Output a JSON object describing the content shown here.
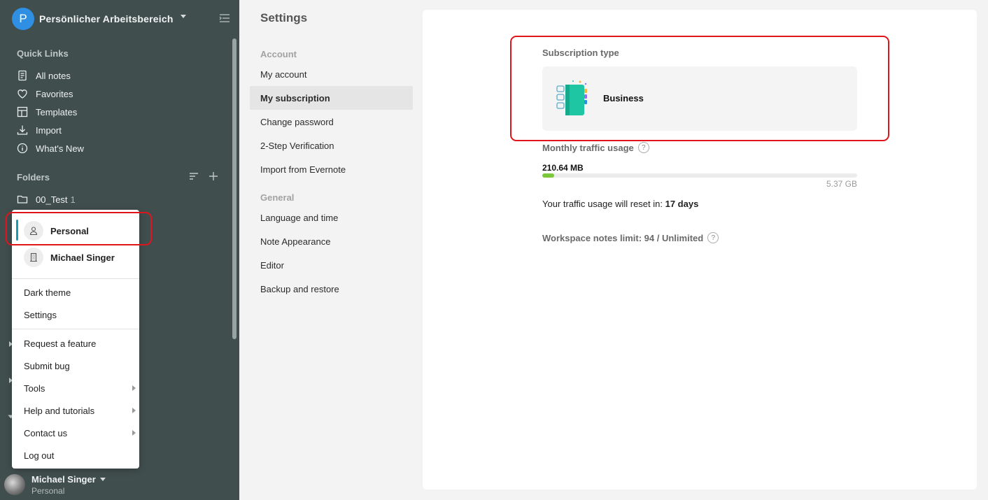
{
  "sidebar": {
    "workspace_initial": "P",
    "workspace_name": "Persönlicher Arbeitsbereich",
    "quick_links_title": "Quick Links",
    "quick_links": [
      {
        "label": "All notes",
        "icon": "note-icon"
      },
      {
        "label": "Favorites",
        "icon": "heart-icon"
      },
      {
        "label": "Templates",
        "icon": "templates-icon"
      },
      {
        "label": "Import",
        "icon": "download-icon"
      },
      {
        "label": "What's New",
        "icon": "info-icon"
      }
    ],
    "folders_title": "Folders",
    "folders": [
      {
        "label": "00_Test",
        "count": "1"
      }
    ],
    "user": {
      "name": "Michael Singer",
      "workspace": "Personal"
    }
  },
  "popup": {
    "workspaces": [
      {
        "label": "Personal",
        "icon": "person-icon",
        "active": true
      },
      {
        "label": "Michael Singer",
        "icon": "building-icon",
        "active": false
      }
    ],
    "group1": [
      "Dark theme",
      "Settings"
    ],
    "group2": [
      {
        "label": "Request a feature",
        "submenu": false
      },
      {
        "label": "Submit bug",
        "submenu": false
      },
      {
        "label": "Tools",
        "submenu": true
      },
      {
        "label": "Help and tutorials",
        "submenu": true
      },
      {
        "label": "Contact us",
        "submenu": true
      },
      {
        "label": "Log out",
        "submenu": false
      }
    ]
  },
  "settings_nav": {
    "title": "Settings",
    "account_group": "Account",
    "account_items": [
      "My account",
      "My subscription",
      "Change password",
      "2-Step Verification",
      "Import from Evernote"
    ],
    "active_item": "My subscription",
    "general_group": "General",
    "general_items": [
      "Language and time",
      "Note Appearance",
      "Editor",
      "Backup and restore"
    ]
  },
  "subscription": {
    "type_label": "Subscription type",
    "plan_name": "Business",
    "traffic_label": "Monthly traffic usage",
    "traffic_used": "210.64 MB",
    "traffic_total": "5.37 GB",
    "traffic_fraction": 0.038,
    "reset_prefix": "Your traffic usage will reset in:",
    "reset_value": "17 days",
    "notes_limit": "Workspace notes limit: 94 / Unlimited",
    "help_glyph": "?"
  },
  "colors": {
    "sidebar_bg": "#414e4e",
    "accent": "#1a9bb5",
    "highlight": "#e0141b",
    "progress": "#7bc93b",
    "avatar": "#2e8fe3"
  }
}
